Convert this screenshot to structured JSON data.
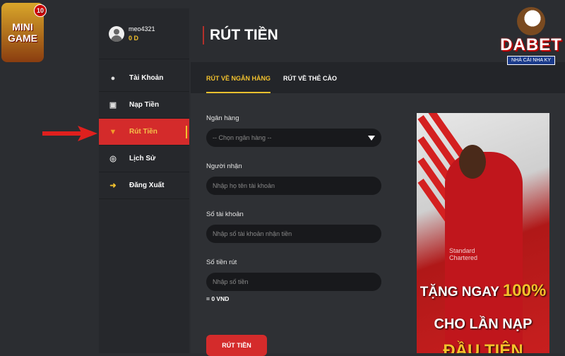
{
  "logos": {
    "left": "MINI GAME",
    "left_badge": "10",
    "right": "DABET",
    "right_sub": "NHÀ CÁI NHA KY"
  },
  "user": {
    "name": "meo4321",
    "balance": "0 D"
  },
  "sidebar": {
    "items": [
      {
        "label": "Tài Khoản",
        "icon": "user-icon"
      },
      {
        "label": "Nạp Tiền",
        "icon": "deposit-icon"
      },
      {
        "label": "Rút Tiền",
        "icon": "withdraw-icon",
        "active": true
      },
      {
        "label": "Lịch Sử",
        "icon": "history-icon"
      },
      {
        "label": "Đăng Xuất",
        "icon": "logout-icon"
      }
    ]
  },
  "page": {
    "title": "RÚT TIỀN"
  },
  "tabs": [
    {
      "label": "RÚT VỀ NGÂN HÀNG",
      "active": true
    },
    {
      "label": "RÚT VỀ THẺ CÀO"
    }
  ],
  "form": {
    "bank_label": "Ngân hàng",
    "bank_placeholder": "-- Chọn ngân hàng --",
    "recipient_label": "Người nhận",
    "recipient_placeholder": "Nhập họ tên tài khoản",
    "account_label": "Số tài khoản",
    "account_placeholder": "Nhập số tài khoản nhận tiền",
    "amount_label": "Số tiền rút",
    "amount_placeholder": "Nhập số tiền",
    "conversion": "= 0 VND",
    "submit": "RÚT TIỀN"
  },
  "banner": {
    "sponsor": "Standard Chartered",
    "line1": "TẶNG NGAY",
    "line1_highlight": "100%",
    "line2": "CHO LẦN NẠP",
    "line3": "ĐẦU TIÊN"
  },
  "colors": {
    "accent": "#f2c12e",
    "active_bg": "#d42b2b",
    "arrow": "#e0201e"
  }
}
